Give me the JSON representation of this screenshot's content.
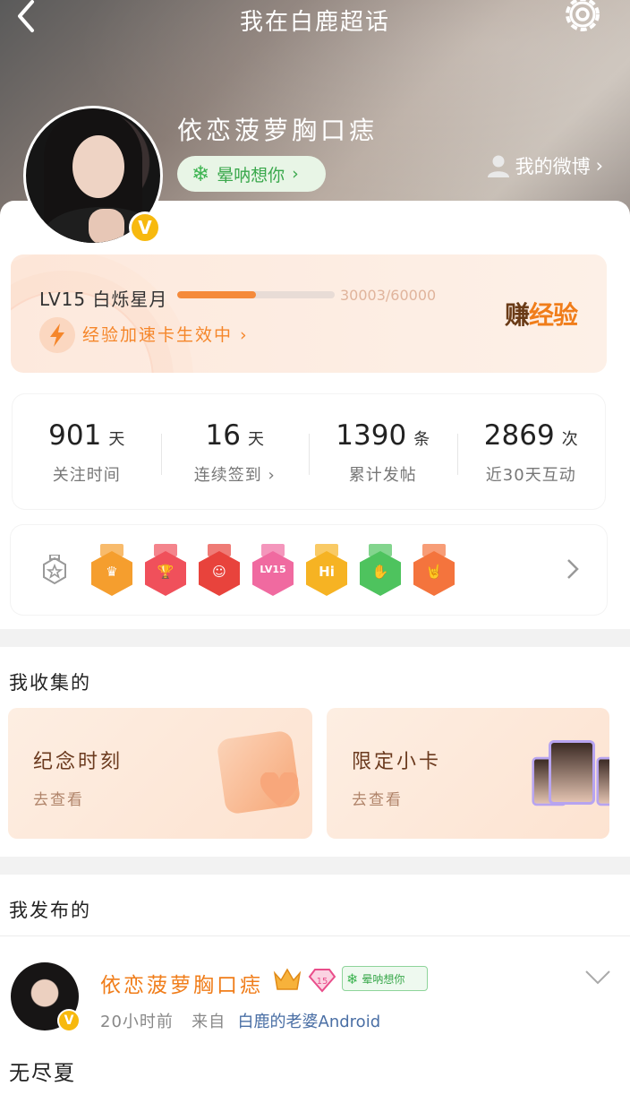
{
  "header": {
    "title": "我在白鹿超话",
    "username": "依恋菠萝胸口痣",
    "group_chip": "晕呐想你",
    "my_weibo": "我的微博"
  },
  "level": {
    "label": "LV15  白烁星月",
    "progress_text": "30003/60000",
    "progress_fraction": 0.5,
    "boost_text": "经验加速卡生效中",
    "earn_label_part1": "赚",
    "earn_label_part2": "经验"
  },
  "stats": [
    {
      "value": "901",
      "unit": "天",
      "label": "关注时间"
    },
    {
      "value": "16",
      "unit": "天",
      "label": "连续签到"
    },
    {
      "value": "1390",
      "unit": "条",
      "label": "累计发帖"
    },
    {
      "value": "2869",
      "unit": "次",
      "label": "近30天互动"
    }
  ],
  "medals": [
    {
      "name": "crown-medal",
      "color": "#f59e2e",
      "glyph": "♛"
    },
    {
      "name": "trophy-medal",
      "color": "#f0505b",
      "glyph": "🏆"
    },
    {
      "name": "mascot-medal",
      "color": "#e8433c",
      "glyph": "☺"
    },
    {
      "name": "lv15-medal",
      "color": "#f06aa0",
      "glyph": "LV15"
    },
    {
      "name": "hi-medal",
      "color": "#f6b323",
      "glyph": "Hi"
    },
    {
      "name": "hand-medal",
      "color": "#4ec35e",
      "glyph": "✋"
    },
    {
      "name": "rock-medal",
      "color": "#f4743d",
      "glyph": "🤘"
    }
  ],
  "collections": {
    "title": "我收集的",
    "cards": [
      {
        "title": "纪念时刻",
        "sub": "去查看"
      },
      {
        "title": "限定小卡",
        "sub": "去查看"
      }
    ]
  },
  "posts": {
    "title": "我发布的",
    "author": "依恋菠萝胸口痣",
    "chip": "晕呐想你",
    "time": "20小时前",
    "from_label": "来自",
    "source": "白鹿的老婆Android",
    "text": "无尽夏"
  },
  "colors": {
    "accent": "#f07d1a",
    "verified": "#f7b90e",
    "green": "#3aa84c"
  }
}
